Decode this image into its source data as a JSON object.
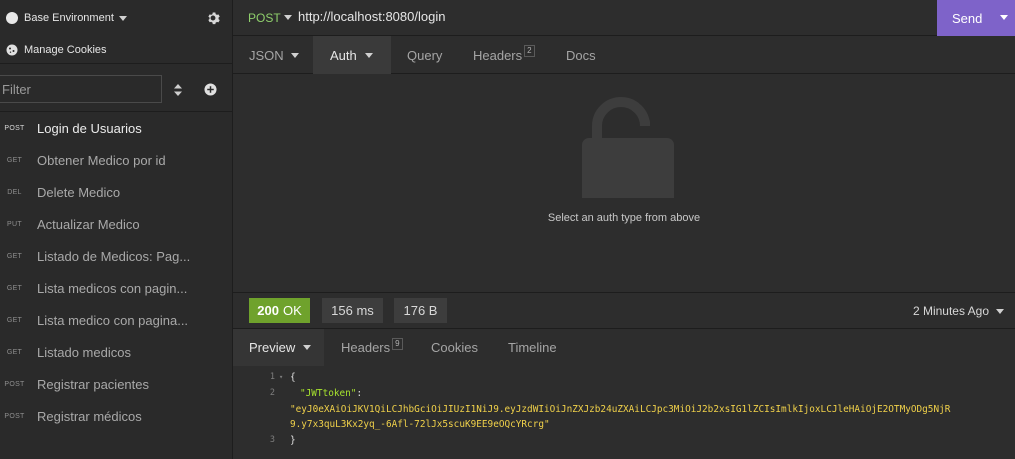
{
  "sidebar": {
    "environment": "Base Environment",
    "manage_cookies": "Manage Cookies",
    "filter_placeholder": "Filter",
    "requests": [
      {
        "method": "POST",
        "name": "Login de Usuarios",
        "active": true
      },
      {
        "method": "GET",
        "name": "Obtener Medico por id"
      },
      {
        "method": "DEL",
        "name": "Delete Medico"
      },
      {
        "method": "PUT",
        "name": "Actualizar Medico"
      },
      {
        "method": "GET",
        "name": "Listado de Medicos: Pag..."
      },
      {
        "method": "GET",
        "name": "Lista medicos con pagin..."
      },
      {
        "method": "GET",
        "name": "Lista medico con pagina..."
      },
      {
        "method": "GET",
        "name": "Listado medicos"
      },
      {
        "method": "POST",
        "name": "Registrar pacientes"
      },
      {
        "method": "POST",
        "name": "Registrar médicos"
      }
    ]
  },
  "request": {
    "method": "POST",
    "url": "http://localhost:8080/login",
    "send_label": "Send",
    "tabs": {
      "body": "JSON",
      "auth": "Auth",
      "query": "Query",
      "headers": "Headers",
      "headers_count": "2",
      "docs": "Docs"
    },
    "auth_hint": "Select an auth type from above"
  },
  "response": {
    "status_code": "200",
    "status_text": "OK",
    "time": "156 ms",
    "size": "176 B",
    "when": "2 Minutes Ago",
    "tabs": {
      "preview": "Preview",
      "headers": "Headers",
      "headers_count": "9",
      "cookies": "Cookies",
      "timeline": "Timeline"
    },
    "body_lines": {
      "l1_num": "1",
      "l1_text": "{",
      "l2_num": "2",
      "l2_key": "\"JWTtoken\"",
      "l2_colon": ":",
      "l2_value_a": "\"eyJ0eXAiOiJKV1QiLCJhbGciOiJIUzI1NiJ9.eyJzdWIiOiJnZXJzb24uZXAiLCJpc3MiOiJ2b2xsIG1lZCIsImlkIjoxLCJleHAiOjE2OTMyODg5NjR",
      "l2_value_b": "9.y7x3quL3Kx2yq_-6Afl-72lJx5scuK9EE9eOQcYRcrg\"",
      "l3_num": "3",
      "l3_text": "}"
    }
  },
  "colors": {
    "accent": "#7e63c9",
    "method_post": "#8fcf6c",
    "status_ok": "#6fa22c",
    "json_key": "#a6e22e",
    "json_string": "#f0d14a"
  },
  "icons": [
    "gear-icon",
    "cookie-icon",
    "sort-icon",
    "plus-circle-icon",
    "unlock-icon",
    "chevron-down-icon"
  ]
}
